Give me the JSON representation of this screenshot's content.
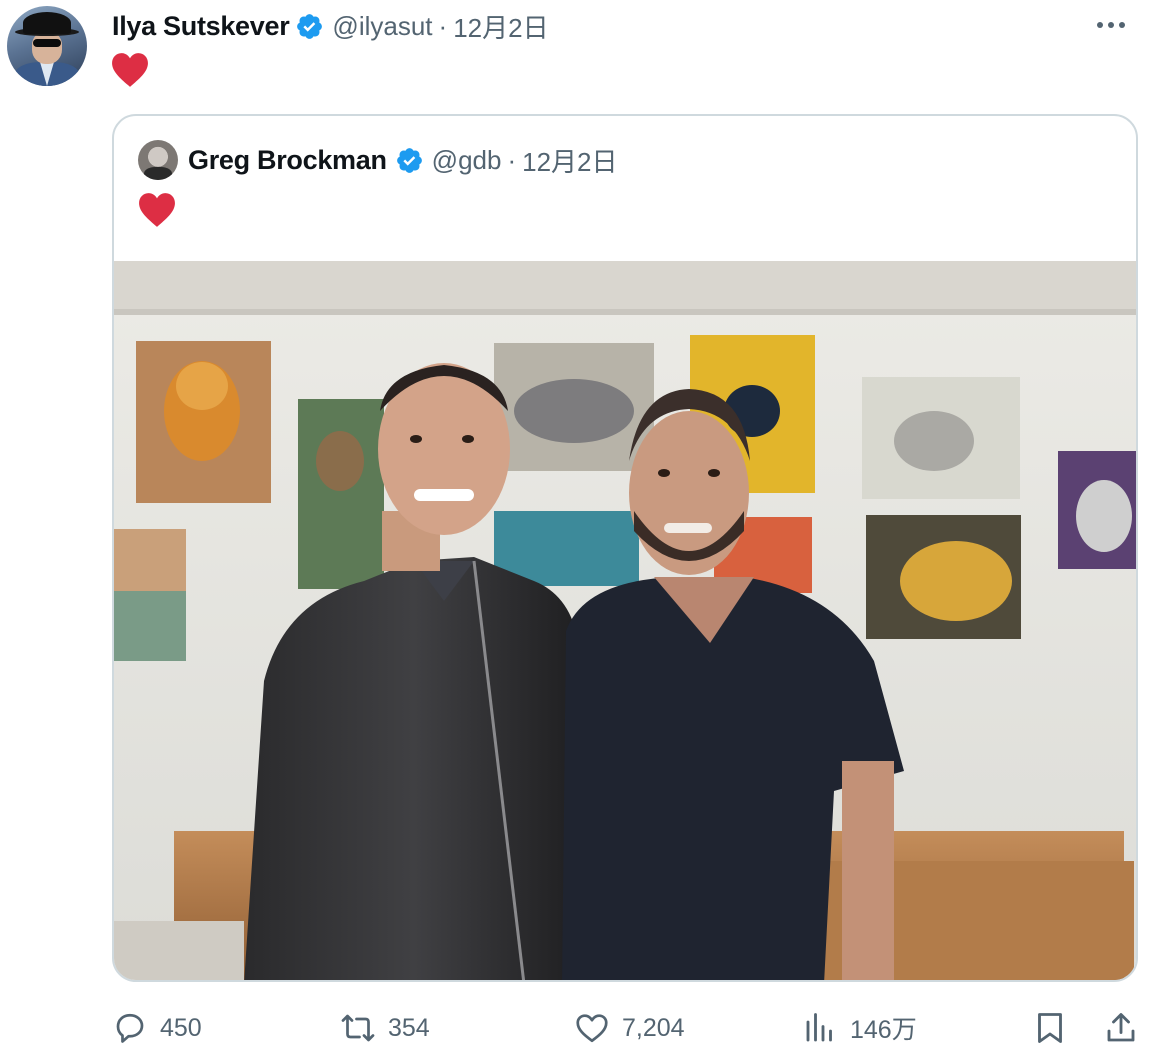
{
  "tweet": {
    "author": {
      "name": "Ilya Sutskever",
      "handle": "@ilyasut",
      "date": "12月2日",
      "verified": true
    },
    "text_emoji": "❤️",
    "quoted": {
      "author": {
        "name": "Greg Brockman",
        "handle": "@gdb",
        "date": "12月2日",
        "verified": true
      },
      "text_emoji": "❤️"
    },
    "stats": {
      "replies": "450",
      "retweets": "354",
      "likes": "7,204",
      "views": "146万"
    }
  },
  "ui": {
    "separator": "·",
    "accent_color": "#1d9bf0",
    "heart_color": "#e0245e",
    "secondary_text_color": "#536471"
  }
}
